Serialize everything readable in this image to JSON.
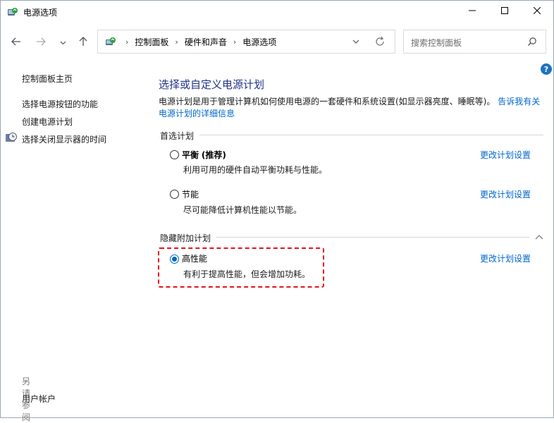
{
  "window": {
    "title": "电源选项",
    "colors": {
      "accent": "#0067c0",
      "link": "#0066cc",
      "title_blue": "#1e3287",
      "highlight_red": "#e3141b"
    }
  },
  "titlebar_buttons": [
    "minimize-icon",
    "maximize-icon",
    "close-icon"
  ],
  "navigation": {
    "back_icon": "arrow-left-icon",
    "forward_icon": "arrow-right-icon",
    "recent_icon": "chevron-down-icon",
    "up_icon": "arrow-up-icon"
  },
  "address": {
    "crumbs": [
      "控制面板",
      "硬件和声音",
      "电源选项"
    ]
  },
  "search": {
    "placeholder": "搜索控制面板"
  },
  "sidebar": {
    "home": "控制面板主页",
    "items": [
      {
        "label": "选择电源按钮的功能"
      },
      {
        "label": "创建电源计划"
      },
      {
        "label": "选择关闭显示器的时间",
        "icon": "clock-icon"
      }
    ],
    "see_also_title": "另请参阅",
    "see_also_items": [
      "用户帐户"
    ]
  },
  "main": {
    "title": "选择或自定义电源计划",
    "description": "电源计划是用于管理计算机如何使用电源的一套硬件和系统设置(如显示器亮度、睡眠等)。",
    "description_link": "告诉我有关电源计划的详细信息",
    "preferred_group": "首选计划",
    "hidden_group": "隐藏附加计划",
    "plans": [
      {
        "name": "平衡",
        "tag": "(推荐)",
        "description": "利用可用的硬件自动平衡功耗与性能。",
        "link": "更改计划设置",
        "selected": false
      },
      {
        "name": "节能",
        "tag": "",
        "description": "尽可能降低计算机性能以节能。",
        "link": "更改计划设置",
        "selected": false
      },
      {
        "name": "高性能",
        "tag": "",
        "description": "有利于提高性能，但会增加功耗。",
        "link": "更改计划设置",
        "selected": true
      }
    ]
  }
}
